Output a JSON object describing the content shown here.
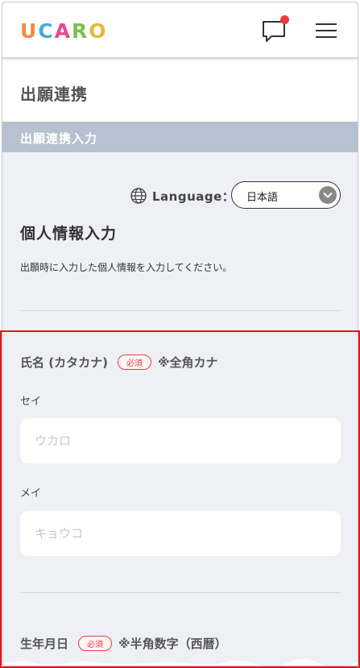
{
  "header": {
    "logo_text": "UCARO",
    "logo_colors": [
      "#ef8a4a",
      "#4aa8d8",
      "#e74b8c",
      "#7cc04b",
      "#e7b93b"
    ],
    "chat_icon": "chat-bubble-icon",
    "menu_icon": "hamburger-menu-icon",
    "notification_color": "#ef3b3b"
  },
  "page": {
    "title": "出願連携",
    "section_header": "出願連携入力"
  },
  "language": {
    "label": "Language：",
    "selected": "日本語"
  },
  "personal_info": {
    "title": "個人情報入力",
    "description": "出願時に入力した個人情報を入力してください。"
  },
  "name_field": {
    "title": "氏名 (カタカナ)",
    "required": "必須",
    "note": "※全角カナ",
    "sei_label": "セイ",
    "sei_placeholder": "ウカロ",
    "mei_label": "メイ",
    "mei_placeholder": "キョウコ"
  },
  "birth_field": {
    "title": "生年月日",
    "required": "必須",
    "note": "※半角数字（西暦）"
  }
}
